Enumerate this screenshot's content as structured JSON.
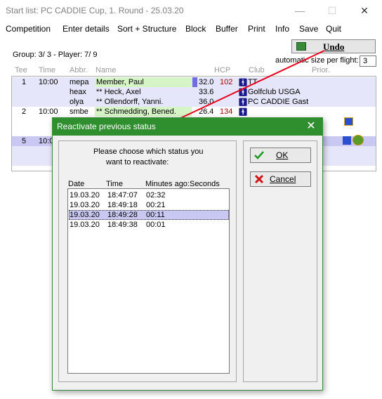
{
  "window": {
    "title": "Start list: PC CADDIE Cup, 1. Round - 25.03.20",
    "min": "—",
    "max": "☐",
    "close": "✕"
  },
  "menu": [
    "Competition",
    "Enter details",
    "Sort + Structure",
    "Block",
    "Buffer",
    "Print",
    "Info",
    "Save",
    "Quit"
  ],
  "header": {
    "group": "Group:  3/  3 - Player:  7/  9",
    "undo_label": "Undo",
    "autosize_label": "automatic size per flight:",
    "autosize_value": "3"
  },
  "columns": [
    "Tee",
    "Time",
    "Abbr.",
    "Name",
    "HCP",
    "Club",
    "Prior."
  ],
  "rows": [
    {
      "tee": "1",
      "time": "10:00",
      "abbr": "mepa",
      "name": "Member, Paul",
      "hcp": "32.0",
      "num": "102",
      "club": "TT"
    },
    {
      "tee": "",
      "time": "",
      "abbr": "heax",
      "name": "** Heck, Axel",
      "hcp": "33.6",
      "num": "",
      "club": "Golfclub USGA"
    },
    {
      "tee": "",
      "time": "",
      "abbr": "olya",
      "name": "** Ollendorff, Yanni.",
      "hcp": "36.0",
      "num": "",
      "club": "PC CADDIE Gast"
    },
    {
      "tee": "2",
      "time": "10:00",
      "abbr": "smbe",
      "name": "** Schmedding, Bened.",
      "hcp": "26.4",
      "num": "134",
      "club": ""
    },
    {
      "tee": "5",
      "time": "10:0",
      "abbr": "",
      "name": "",
      "hcp": "",
      "num": "",
      "club": ""
    }
  ],
  "dialog": {
    "title": "Reactivate previous status",
    "close": "✕",
    "prompt_line1": "Please choose which status you",
    "prompt_line2": "want to reactivate:",
    "col_date": "Date",
    "col_time": "Time",
    "col_ago": "Minutes ago:Seconds",
    "statuses": [
      {
        "date": "19.03.20",
        "time": "18:47:07",
        "ago": "02:32"
      },
      {
        "date": "19.03.20",
        "time": "18:49:18",
        "ago": "00:21"
      },
      {
        "date": "19.03.20",
        "time": "18:49:28",
        "ago": "00:11"
      },
      {
        "date": "19.03.20",
        "time": "18:49:38",
        "ago": "00:01"
      }
    ],
    "selected_index": 2,
    "ok_label": "OK",
    "cancel_label": "Cancel"
  },
  "colors": {
    "dialog_title": "#2f8f2f",
    "selection": "#c8c8f2",
    "row_highlight": "#e6e6fa",
    "name_green": "#d6f5c6",
    "hcp_red": "#b00000",
    "arrow": "#e8001c"
  }
}
